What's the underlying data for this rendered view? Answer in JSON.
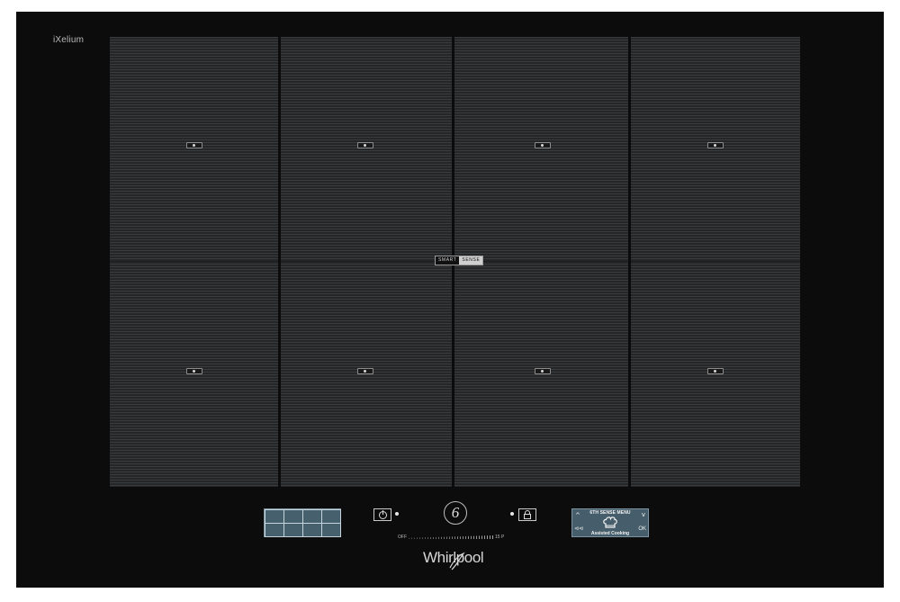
{
  "brand": {
    "series": "iXelium",
    "logo": "Whirlpool"
  },
  "cooktop": {
    "columns": 4,
    "zone_markers_per_column": 2,
    "smart_sense": {
      "part1": "SMART",
      "part2": "SENSE"
    }
  },
  "controls": {
    "zone_grid": {
      "columns": 4,
      "rows": 2
    },
    "power_icon": "power-icon",
    "lock_icon": "lock-icon",
    "sixth_sense_logo": "6",
    "slider": {
      "min_label": "OFF",
      "max_label": "15 P"
    },
    "display": {
      "title": "6TH SENSE MENU",
      "subtitle": "Assisted Cooking",
      "icon": "chef-hat-icon",
      "up_arrow": "^",
      "down_arrow": "v",
      "back_arrow": "⊲⊲",
      "ok_label": "OK"
    }
  },
  "colors": {
    "frame": "#0c0c0d",
    "zone": "#2f3032",
    "display_bg": "#465e6b"
  }
}
